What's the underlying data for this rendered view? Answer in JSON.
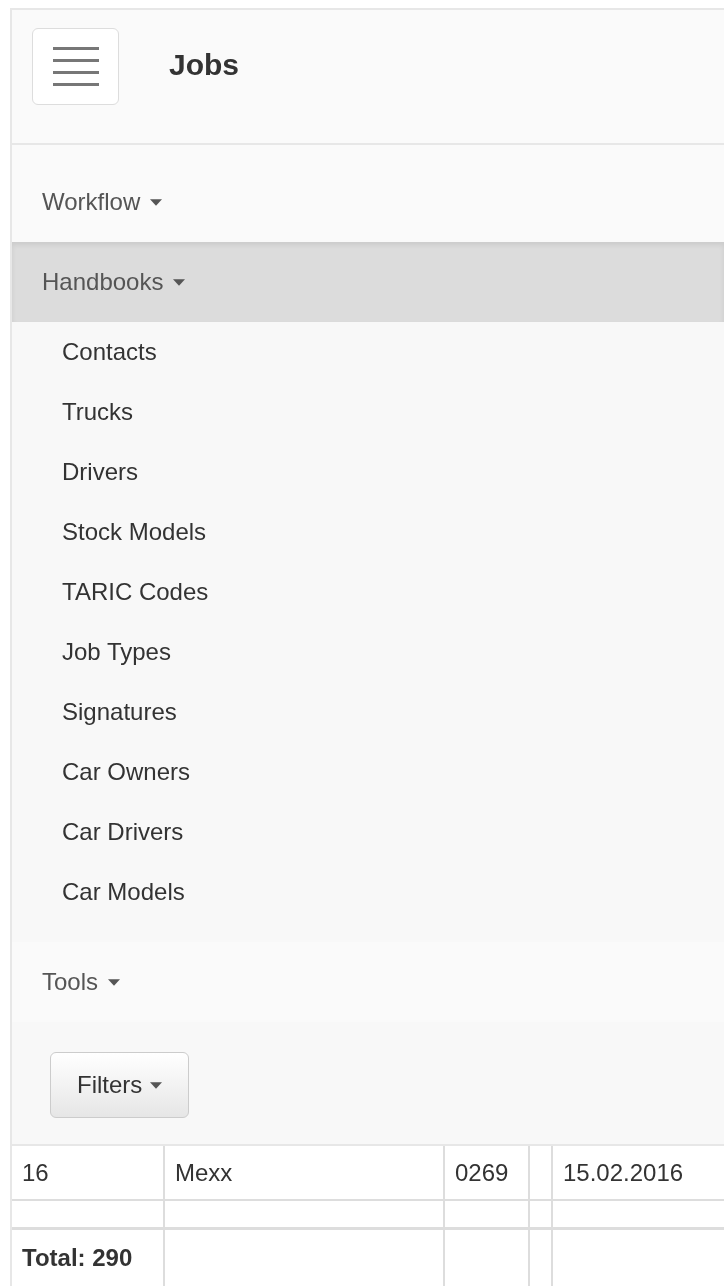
{
  "navbar": {
    "title": "Jobs"
  },
  "menu": [
    {
      "label": "Workflow",
      "expanded": false
    },
    {
      "label": "Handbooks",
      "expanded": true,
      "children": [
        {
          "label": "Contacts"
        },
        {
          "label": "Trucks"
        },
        {
          "label": "Drivers"
        },
        {
          "label": "Stock Models"
        },
        {
          "label": "TARIC Codes"
        },
        {
          "label": "Job Types"
        },
        {
          "label": "Signatures"
        },
        {
          "label": "Car Owners"
        },
        {
          "label": "Car Drivers"
        },
        {
          "label": "Car Models"
        }
      ]
    },
    {
      "label": "Tools",
      "expanded": false
    }
  ],
  "filters_button": {
    "label": "Filters"
  },
  "table": {
    "rows": [
      {
        "column_1": "16",
        "column_2": "Mexx",
        "column_3": "0269",
        "column_5": "15.02.2016"
      }
    ],
    "footer": {
      "total": "Total: 290"
    }
  }
}
